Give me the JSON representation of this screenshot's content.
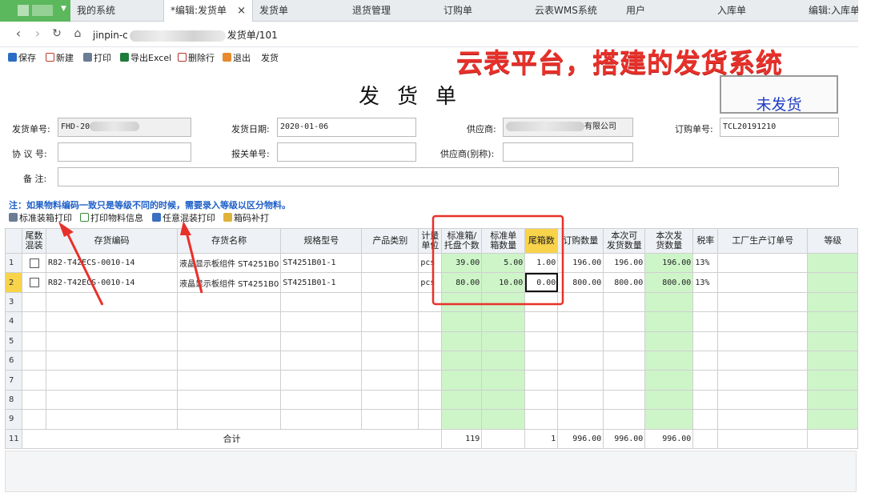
{
  "tabs": [
    {
      "label": "我的系统",
      "active": false
    },
    {
      "label": "*编辑:发货单",
      "active": true,
      "close": "×"
    },
    {
      "label": "发货单",
      "active": false
    },
    {
      "label": "退货管理",
      "active": false
    },
    {
      "label": "订购单",
      "active": false
    },
    {
      "label": "云表WMS系统",
      "active": false
    },
    {
      "label": "用户",
      "active": false
    },
    {
      "label": "入库单",
      "active": false
    },
    {
      "label": "编辑:入库单",
      "active": false
    }
  ],
  "address": {
    "prefix": "jinpin-c",
    "suffix": "发货单/101"
  },
  "toolbar": {
    "save": "保存",
    "new": "新建",
    "print": "打印",
    "export": "导出Excel",
    "delete_row": "删除行",
    "exit": "退出",
    "ship": "发货"
  },
  "overlay_title": "云表平台，搭建的发货系统",
  "form": {
    "doc_title": "发货单",
    "status": "未发货",
    "ship_no_label": "发货单号:",
    "ship_no_value": "FHD-20",
    "ship_date_label": "发货日期:",
    "ship_date_value": "2020-01-06",
    "supplier_label": "供应商:",
    "supplier_value": "有限公司",
    "order_no_label": "订购单号:",
    "order_no_value": "TCL20191210",
    "agreement_label": "协 议 号:",
    "agreement_value": "",
    "customs_label": "报关单号:",
    "customs_value": "",
    "supplier_alias_label": "供应商(别称):",
    "supplier_alias_value": "",
    "remark_label": "备  注:",
    "remark_value": ""
  },
  "notice": "注：如果物料编码一致只是等级不同的时候，需要录入等级以区分物料。",
  "sub_toolbar": {
    "std_print": "标准装箱打印",
    "print_material": "打印物料信息",
    "mixed_print": "任意混装打印",
    "barcode": "箱码补打"
  },
  "grid": {
    "headers": [
      "尾数\n混装",
      "存货编码",
      "存货名称",
      "规格型号",
      "产品类别",
      "计量\n单位",
      "标准箱/\n托盘个数",
      "标准单\n箱数量",
      "尾箱数",
      "订购数量",
      "本次可\n发货数量",
      "本次发\n货数量",
      "税率",
      "工厂生产订单号",
      "等级"
    ],
    "rows": [
      {
        "n": "1",
        "code": "R82-T42ECS-0010-14",
        "name": "液晶显示板组件 ST4251B0",
        "spec": "ST4251B01-1",
        "cat": "",
        "unit": "pcs",
        "std_box": "39.00",
        "box_qty": "5.00",
        "tail": "1.00",
        "order_qty": "196.00",
        "avail": "196.00",
        "ship": "196.00",
        "tax": "13%",
        "factory": "",
        "grade": ""
      },
      {
        "n": "2",
        "code": "R82-T42ECS-0010-14",
        "name": "液晶显示板组件 ST4251B0",
        "spec": "ST4251B01-1",
        "cat": "",
        "unit": "pcs",
        "std_box": "80.00",
        "box_qty": "10.00",
        "tail": "0.00",
        "order_qty": "800.00",
        "avail": "800.00",
        "ship": "800.00",
        "tax": "13%",
        "factory": "",
        "grade": ""
      }
    ],
    "empty_rows": [
      "3",
      "4",
      "5",
      "6",
      "7",
      "8",
      "9"
    ],
    "total": {
      "n": "11",
      "label": "合计",
      "std_box": "119",
      "tail": "1",
      "order_qty": "996.00",
      "avail": "996.00",
      "ship": "996.00"
    }
  },
  "colors": {
    "accent_green": "#cdf5c8",
    "highlight_yellow": "#f8d34b",
    "annotation_red": "#e8302a",
    "status_blue": "#1f3cc4"
  },
  "icons": [
    "save-icon",
    "new-icon",
    "print-icon",
    "excel-icon",
    "delete-row-icon",
    "exit-icon",
    "back-icon",
    "forward-icon",
    "refresh-icon",
    "home-icon",
    "box-print-icon",
    "document-print-icon",
    "mixed-print-icon",
    "barcode-icon"
  ]
}
